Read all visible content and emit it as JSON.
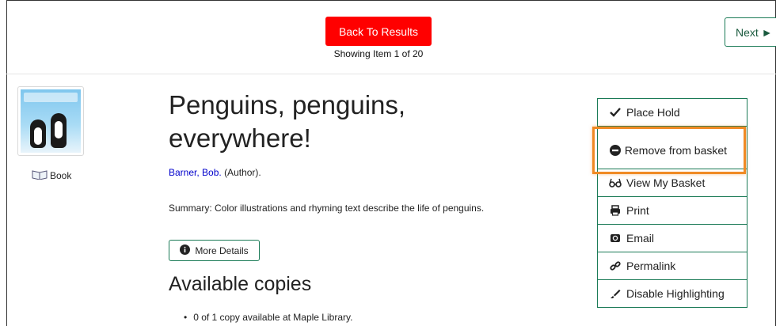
{
  "nav": {
    "back_label": "Back To Results",
    "showing_text": "Showing Item 1 of 20",
    "next_label": "Next ►"
  },
  "record": {
    "title": "Penguins, penguins, everywhere!",
    "author_name": "Barner, Bob.",
    "author_role": "(Author).",
    "summary": "Summary: Color illustrations and rhyming text describe the life of penguins.",
    "more_details_label": "More Details",
    "format_label": "Book",
    "format_icon": "book-icon"
  },
  "availability": {
    "heading": "Available copies",
    "copies": [
      "0 of 1 copy available at Maple Library."
    ]
  },
  "actions": [
    {
      "label": "Place Hold",
      "icon": "checkmark-icon"
    },
    {
      "label": "Remove from basket",
      "icon": "minus-circle-icon"
    },
    {
      "label": "View My Basket",
      "icon": "glasses-icon"
    },
    {
      "label": "Print",
      "icon": "printer-icon"
    },
    {
      "label": "Email",
      "icon": "envelope-icon"
    },
    {
      "label": "Permalink",
      "icon": "link-icon"
    },
    {
      "label": "Disable Highlighting",
      "icon": "marker-icon"
    }
  ],
  "colors": {
    "back_button": "#ff0000",
    "accent_border": "#1a7a56",
    "highlight": "#f08a24",
    "link": "#0000cc"
  }
}
